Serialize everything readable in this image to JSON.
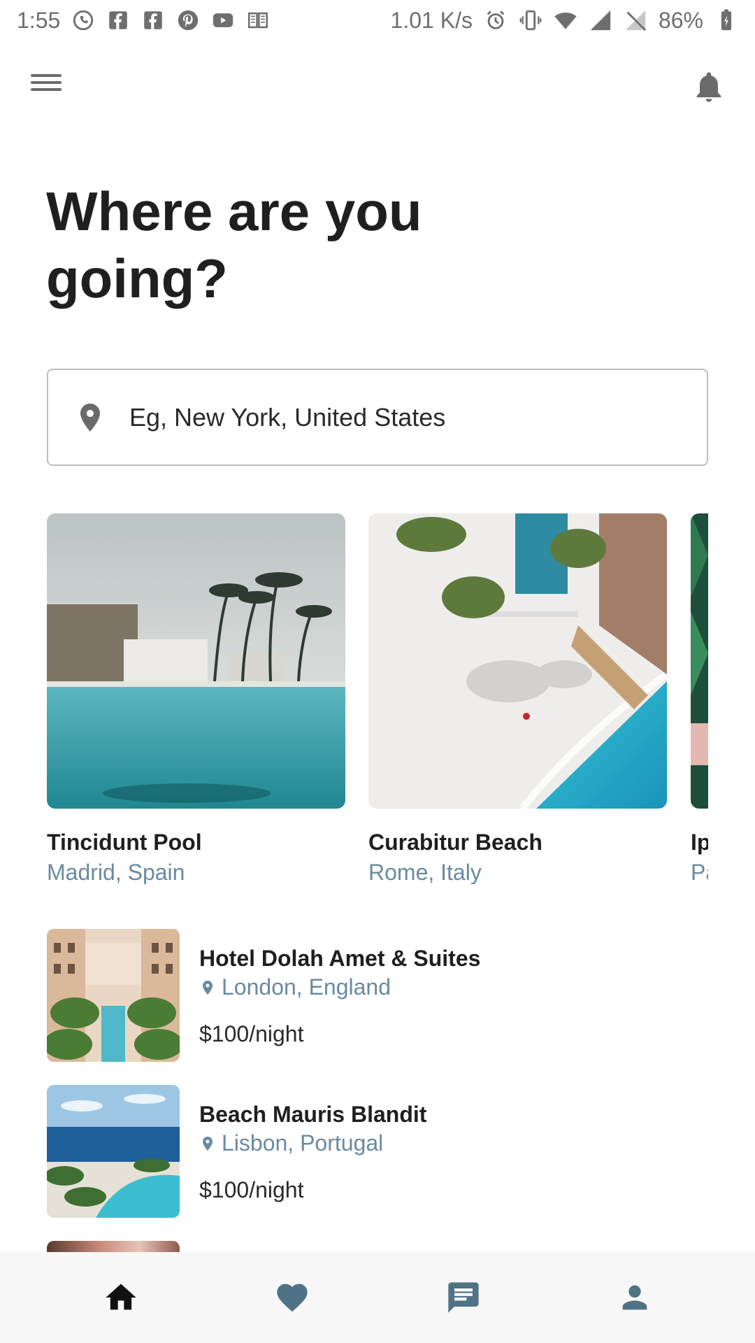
{
  "status_bar": {
    "time": "1:55",
    "net_speed": "1.01 K/s",
    "battery": "86%",
    "left_icons": [
      "whatsapp-icon",
      "facebook-icon",
      "facebook-icon",
      "pinterest-icon",
      "youtube-icon",
      "reader-icon"
    ],
    "right_icons": [
      "alarm-icon",
      "vibrate-icon",
      "wifi-icon",
      "signal-icon",
      "no-sim-icon",
      "battery-icon"
    ]
  },
  "header": {
    "menu_icon": "hamburger-menu-icon",
    "notification_icon": "bell-icon"
  },
  "title": "Where are you going?",
  "search": {
    "placeholder": "Eg, New York, United States",
    "icon": "location-pin-icon"
  },
  "featured": [
    {
      "name": "Tincidunt Pool",
      "location": "Madrid, Spain"
    },
    {
      "name": "Curabitur Beach",
      "location": "Rome, Italy"
    },
    {
      "name": "Ip",
      "location": "Pa"
    }
  ],
  "listings": [
    {
      "name": "Hotel Dolah Amet & Suites",
      "location": "London, England",
      "price": "$100/night"
    },
    {
      "name": "Beach Mauris Blandit",
      "location": "Lisbon, Portugal",
      "price": "$100/night"
    }
  ],
  "bottom_nav": [
    {
      "icon": "home-icon",
      "active": true
    },
    {
      "icon": "heart-icon",
      "active": false
    },
    {
      "icon": "chat-icon",
      "active": false
    },
    {
      "icon": "person-icon",
      "active": false
    }
  ],
  "colors": {
    "accent_blue_gray": "#6a8aa0",
    "nav_active": "#111111",
    "nav_inactive": "#4f7286"
  }
}
